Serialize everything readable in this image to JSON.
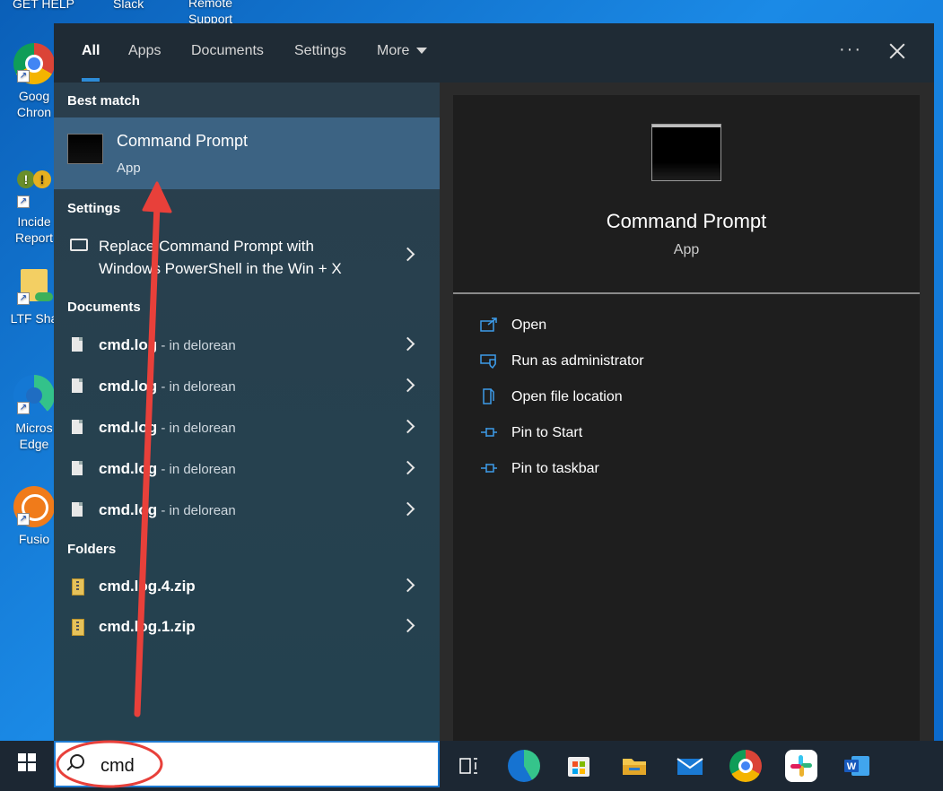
{
  "desktop": {
    "top_labels": [
      "GET HELP",
      "Slack",
      "Remote\nSupport"
    ],
    "icons": [
      {
        "label": "Goog\nChron",
        "icon": "chrome-icon"
      },
      {
        "label": "Incide\nReport",
        "icon": "incident-report-icon"
      },
      {
        "label": "LTF Sha",
        "icon": "folder-icon"
      },
      {
        "label": "Micros\nEdge",
        "icon": "edge-icon"
      },
      {
        "label": "Fusio",
        "icon": "fusion-icon"
      }
    ]
  },
  "tabs": [
    {
      "label": "All",
      "active": true
    },
    {
      "label": "Apps"
    },
    {
      "label": "Documents"
    },
    {
      "label": "Settings"
    },
    {
      "label": "More"
    }
  ],
  "header": {
    "more_dots": "···"
  },
  "results": {
    "best_match_header": "Best match",
    "best_match": {
      "title": "Command Prompt",
      "subtitle": "App"
    },
    "settings_header": "Settings",
    "settings_item": {
      "line1": "Replace Command Prompt with",
      "line2": "Windows PowerShell in the Win + X"
    },
    "documents_header": "Documents",
    "documents": [
      {
        "name": "cmd.log",
        "location": " - in delorean"
      },
      {
        "name": "cmd.log",
        "location": " - in delorean"
      },
      {
        "name": "cmd.log",
        "location": " - in delorean"
      },
      {
        "name": "cmd.log",
        "location": " - in delorean"
      },
      {
        "name": "cmd.log",
        "location": " - in delorean"
      }
    ],
    "folders_header": "Folders",
    "folders": [
      {
        "name": "cmd.log.4.zip"
      },
      {
        "name": "cmd.log.1.zip"
      }
    ]
  },
  "preview": {
    "title": "Command Prompt",
    "subtitle": "App",
    "actions": [
      {
        "label": "Open",
        "icon": "open-icon"
      },
      {
        "label": "Run as administrator",
        "icon": "run-as-admin-icon"
      },
      {
        "label": "Open file location",
        "icon": "file-location-icon"
      },
      {
        "label": "Pin to Start",
        "icon": "pin-icon"
      },
      {
        "label": "Pin to taskbar",
        "icon": "pin-icon"
      }
    ]
  },
  "taskbar": {
    "search_value": "cmd",
    "apps": [
      "task-view-icon",
      "edge-icon",
      "store-icon",
      "file-explorer-icon",
      "mail-icon",
      "chrome-icon",
      "slack-icon",
      "word-icon"
    ]
  },
  "colors": {
    "accent": "#2d8cd8",
    "annotation_red": "#e8403a",
    "selected_row": "#3c6383"
  }
}
